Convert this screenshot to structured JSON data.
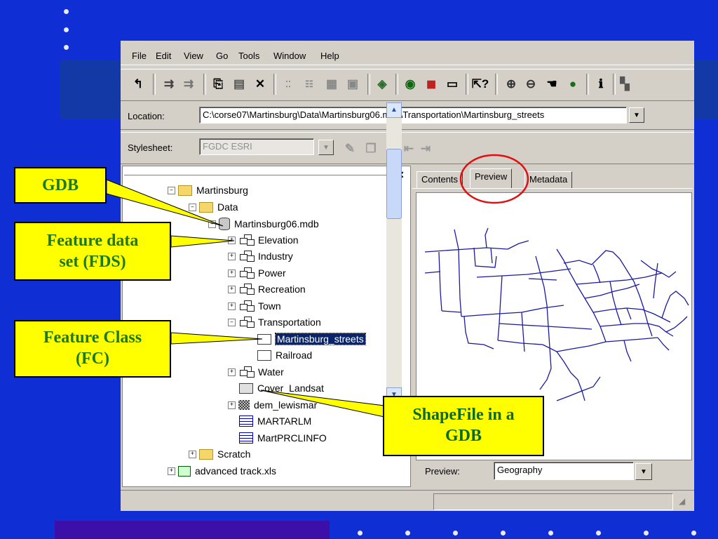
{
  "menu": [
    "File",
    "Edit",
    "View",
    "Go",
    "Tools",
    "Window",
    "Help"
  ],
  "location": {
    "label": "Location:",
    "path": "C:\\corse07\\Martinsburg\\Data\\Martinsburg06.mdb\\Transportation\\Martinsburg_streets"
  },
  "stylesheet": {
    "label": "Stylesheet:",
    "value": "FGDC ESRI"
  },
  "tabs": [
    "Contents",
    "Preview",
    "Metadata"
  ],
  "active_tab": "Preview",
  "preview": {
    "label": "Preview:",
    "value": "Geography"
  },
  "tree": {
    "martinsburg": "Martinsburg",
    "data": "Data",
    "mdb": "Martinsburg06.mdb",
    "elevation": "Elevation",
    "industry": "Industry",
    "power": "Power",
    "recreation": "Recreation",
    "town": "Town",
    "transportation": "Transportation",
    "streets": "Martinsburg_streets",
    "railroad": "Railroad",
    "water": "Water",
    "cover": "Cover_Landsat",
    "dem": "dem_lewismar",
    "martarlm": "MARTARLM",
    "martprcl": "MartPRCLINFO",
    "scratch": "Scratch",
    "xls": "advanced track.xls"
  },
  "callouts": {
    "gdb": "GDB",
    "fds_line1": "Feature data",
    "fds_line2": "set (FDS)",
    "fc_line1": "Feature Class",
    "fc_line2": "(FC)",
    "shp_line1": "ShapeFile in a",
    "shp_line2": "GDB"
  },
  "colors": {
    "background": "#0f2ed4",
    "callout": "#ffff00",
    "callout_text": "#1a7a1a",
    "selection": "#0a246a",
    "map_lines": "#1a1aa0",
    "highlight_circle": "#e01010"
  }
}
